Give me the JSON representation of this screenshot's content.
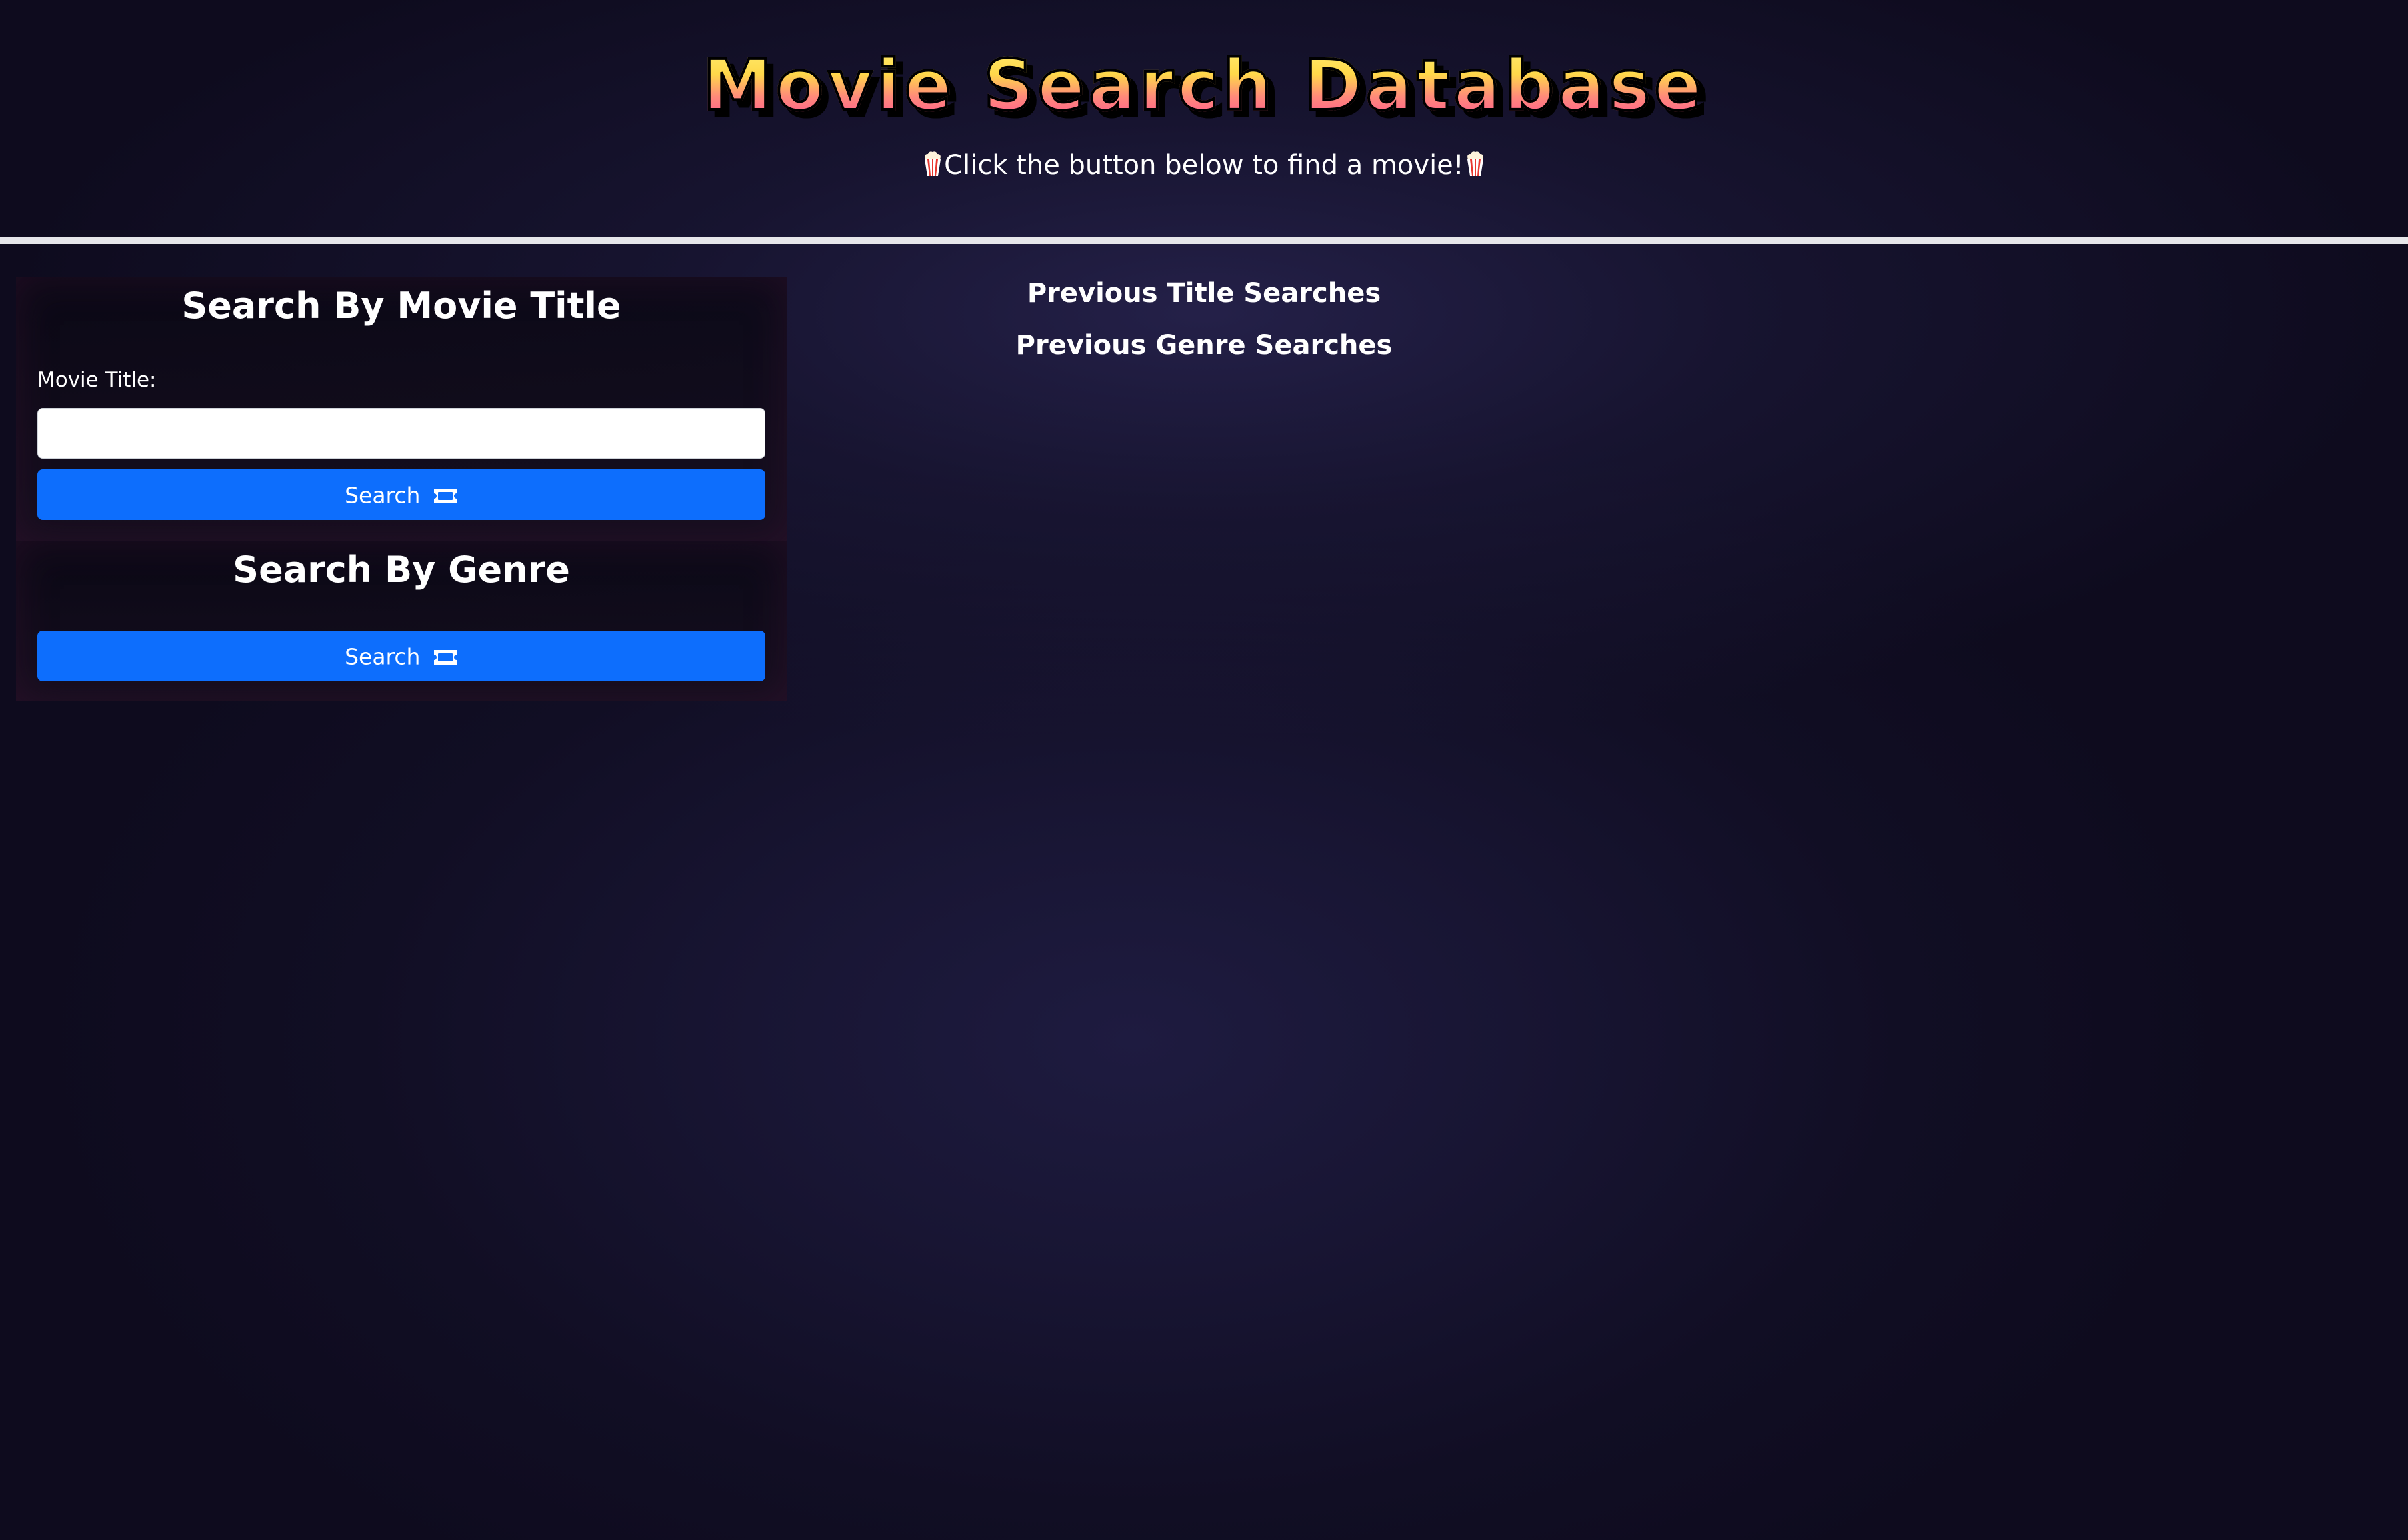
{
  "header": {
    "title": "Movie Search Database",
    "subtitle": "Click the button below to find a movie!",
    "subtitle_icon": "popcorn-icon"
  },
  "title_search": {
    "heading": "Search By Movie Title",
    "field_label": "Movie Title:",
    "input_value": "",
    "input_placeholder": "",
    "button_label": "Search",
    "button_icon": "ticket-icon"
  },
  "genre_search": {
    "heading": "Search By Genre",
    "button_label": "Search",
    "button_icon": "ticket-icon"
  },
  "history": {
    "title_heading": "Previous Title Searches",
    "genre_heading": "Previous Genre Searches"
  },
  "colors": {
    "background": "#0e0b1e",
    "button_primary": "#0d6efd",
    "title_gradient_top": "#fff27a",
    "title_gradient_bottom": "#ff3f9c",
    "divider": "#e6e6ea"
  }
}
